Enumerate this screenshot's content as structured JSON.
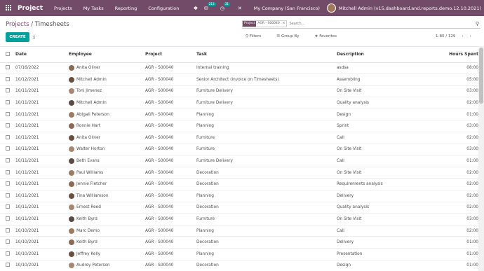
{
  "navbar": {
    "app_title": "Project",
    "menus": [
      "Projects",
      "My Tasks",
      "Reporting",
      "Configuration"
    ],
    "messages_badge": "213",
    "activity_badge": "31",
    "company": "My Company (San Francisco)",
    "user": "Mitchell Admin (v15.dashboard.and.reports.demo.12.10.2021)",
    "brand_color": "#714b67"
  },
  "breadcrumb": {
    "parent": "Projects",
    "separator": " / ",
    "current": "Timesheets"
  },
  "search": {
    "facet_label": "Project",
    "facet_value": "AGR - S00040",
    "placeholder": "Search..."
  },
  "toolbar": {
    "create_label": "CREATE",
    "filters_label": "Filters",
    "group_by_label": "Group By",
    "favorites_label": "Favorites",
    "pager": "1-80 / 129"
  },
  "table": {
    "headers": [
      "Date",
      "Employee",
      "Project",
      "Task",
      "Description",
      "Hours Spent"
    ],
    "rows": [
      {
        "date": "07/16/2022",
        "employee": "Anita Oliver",
        "project": "AGR - S00040",
        "task": "Internal training",
        "description": "asdsa",
        "hours": "08:00"
      },
      {
        "date": "10/12/2021",
        "employee": "Mitchell Admin",
        "project": "AGR - S00040",
        "task": "Senior Architect (Invoice on Timesheets)",
        "description": "Assembling",
        "hours": "05:00"
      },
      {
        "date": "10/11/2021",
        "employee": "Toni Jimenez",
        "project": "AGR - S00040",
        "task": "Furniture Delivery",
        "description": "On Site Visit",
        "hours": "03:00"
      },
      {
        "date": "10/11/2021",
        "employee": "Mitchell Admin",
        "project": "AGR - S00040",
        "task": "Furniture Delivery",
        "description": "Quality analysis",
        "hours": "02:00"
      },
      {
        "date": "10/11/2021",
        "employee": "Abigail Peterson",
        "project": "AGR - S00040",
        "task": "Planning",
        "description": "Design",
        "hours": "01:00"
      },
      {
        "date": "10/11/2021",
        "employee": "Ronnie Hart",
        "project": "AGR - S00040",
        "task": "Planning",
        "description": "Sprint",
        "hours": "03:00"
      },
      {
        "date": "10/11/2021",
        "employee": "Anita Oliver",
        "project": "AGR - S00040",
        "task": "Furniture",
        "description": "Call",
        "hours": "02:00"
      },
      {
        "date": "10/11/2021",
        "employee": "Walter Horton",
        "project": "AGR - S00040",
        "task": "Furniture",
        "description": "On Site Visit",
        "hours": "03:00"
      },
      {
        "date": "10/11/2021",
        "employee": "Beth Evans",
        "project": "AGR - S00040",
        "task": "Furniture Delivery",
        "description": "Call",
        "hours": "01:00"
      },
      {
        "date": "10/11/2021",
        "employee": "Paul Williams",
        "project": "AGR - S00040",
        "task": "Decoration",
        "description": "On Site Visit",
        "hours": "02:00"
      },
      {
        "date": "10/11/2021",
        "employee": "Jennie Fletcher",
        "project": "AGR - S00040",
        "task": "Decoration",
        "description": "Requirements analysis",
        "hours": "02:00"
      },
      {
        "date": "10/11/2021",
        "employee": "Tina Williamson",
        "project": "AGR - S00040",
        "task": "Planning",
        "description": "Delivery",
        "hours": "02:00"
      },
      {
        "date": "10/11/2021",
        "employee": "Ernest Reed",
        "project": "AGR - S00040",
        "task": "Decoration",
        "description": "Quality analysis",
        "hours": "02:00"
      },
      {
        "date": "10/11/2021",
        "employee": "Keith Byrd",
        "project": "AGR - S00040",
        "task": "Furniture",
        "description": "On Site Visit",
        "hours": "03:00"
      },
      {
        "date": "10/10/2021",
        "employee": "Marc Demo",
        "project": "AGR - S00040",
        "task": "Planning",
        "description": "Call",
        "hours": "02:00"
      },
      {
        "date": "10/10/2021",
        "employee": "Keith Byrd",
        "project": "AGR - S00040",
        "task": "Decoration",
        "description": "Delivery",
        "hours": "01:00"
      },
      {
        "date": "10/10/2021",
        "employee": "Jeffrey Kelly",
        "project": "AGR - S00040",
        "task": "Planning",
        "description": "Presentation",
        "hours": "01:00"
      },
      {
        "date": "10/10/2021",
        "employee": "Audrey Peterson",
        "project": "AGR - S00040",
        "task": "Decoration",
        "description": "Design",
        "hours": "01:00"
      }
    ]
  },
  "colors": {
    "accent": "#00a09d"
  }
}
